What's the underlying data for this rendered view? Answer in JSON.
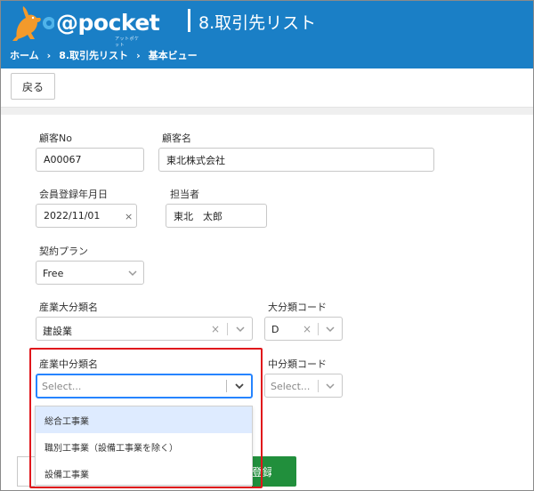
{
  "header": {
    "logo_text": "@pocket",
    "logo_sub": "アットポケット",
    "title": "8.取引先リスト"
  },
  "breadcrumb": {
    "items": [
      "ホーム",
      "8.取引先リスト",
      "基本ビュー"
    ],
    "separator": "›"
  },
  "toolbar": {
    "back_label": "戻る"
  },
  "form": {
    "customer_no": {
      "label": "顧客No",
      "value": "A00067"
    },
    "customer_name": {
      "label": "顧客名",
      "value": "東北株式会社"
    },
    "member_date": {
      "label": "会員登録年月日",
      "value": "2022/11/01",
      "clear": "×"
    },
    "staff": {
      "label": "担当者",
      "value": "東北　太郎"
    },
    "plan": {
      "label": "契約プラン",
      "value": "Free"
    },
    "industry_major": {
      "label": "産業大分類名",
      "value": "建設業",
      "clear": "×"
    },
    "major_code": {
      "label": "大分類コード",
      "value": "D",
      "clear": "×"
    },
    "industry_middle": {
      "label": "産業中分類名",
      "placeholder": "Select..."
    },
    "middle_code": {
      "label": "中分類コード",
      "placeholder": "Select..."
    }
  },
  "dropdown": {
    "options": [
      "総合工事業",
      "職別工事業（設備工事業を除く）",
      "設備工事業"
    ],
    "active_index": 0
  },
  "register_label": "登録",
  "colors": {
    "header_bg": "#1a7fc6",
    "highlight": "#e0161b",
    "register_bg": "#218f3c",
    "option_active": "#deebff",
    "focus_border": "#2684ff"
  }
}
